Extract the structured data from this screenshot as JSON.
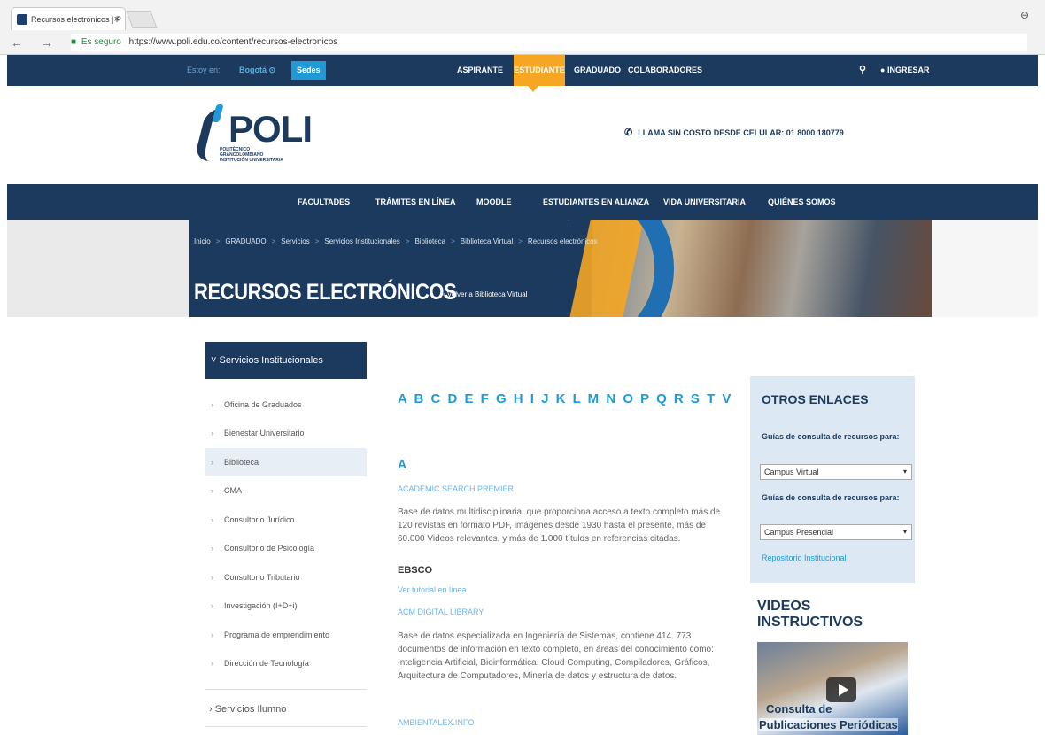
{
  "browser": {
    "tab_title": "Recursos electrónicos | P",
    "tab_close": "×",
    "address_secure": "Es seguro",
    "address_url": "https://www.poli.edu.co/content/recursos-electronicos",
    "nav_buttons": "← → C",
    "profile_icon": "⊖"
  },
  "topbar": {
    "estoy_en": "Estoy en:",
    "city": "Bogotá ⊙",
    "sedes": "Sedes",
    "tabs": [
      "ASPIRANTE",
      "ESTUDIANTE",
      "GRADUADO",
      "COLABORADORES"
    ],
    "active_tab": "ESTUDIANTE",
    "search_icon": "search-icon",
    "login": "INGRESAR"
  },
  "header": {
    "logo_text": "POLI",
    "logo_sub": "POLITÉCNICO GRANCOLOMBIANO INSTITUCIÓN UNIVERSITARIA",
    "phone_text": "LLAMA SIN COSTO DESDE CELULAR: 01 8000 180779"
  },
  "mainnav": {
    "items": [
      "FACULTADES",
      "TRÁMITES EN LÍNEA",
      "MOODLE",
      "ESTUDIANTES EN ALIANZA",
      "VIDA UNIVERSITARIA",
      "QUIÉNES SOMOS"
    ]
  },
  "banner": {
    "breadcrumb": [
      "Inicio",
      "GRADUADO",
      "Servicios",
      "Servicios Institucionales",
      "Biblioteca",
      "Biblioteca Virtual",
      "Recursos electrónicos"
    ],
    "breadcrumb_sep": ">",
    "title": "RECURSOS ELECTRÓNICOS",
    "back_link": "‹ Volver a Biblioteca Virtual"
  },
  "sidebar": {
    "header": "˅ Servicios Institucionales",
    "items": [
      {
        "label": "Oficina de Graduados",
        "active": false
      },
      {
        "label": "Bienestar Universitario",
        "active": false
      },
      {
        "label": "Biblioteca",
        "active": true
      },
      {
        "label": "CMA",
        "active": false
      },
      {
        "label": "Consultorio Jurídico",
        "active": false
      },
      {
        "label": "Consultorio de Psicología",
        "active": false
      },
      {
        "label": "Consultorio Tributario",
        "active": false
      },
      {
        "label": "Investigación (I+D+i)",
        "active": false
      },
      {
        "label": "Programa de emprendimiento",
        "active": false
      },
      {
        "label": "Dirección de Tecnología",
        "active": false
      }
    ],
    "chevron": "›",
    "extra": "› Servicios Ilumno"
  },
  "content": {
    "alphabet": "A B C D E F G H I J K L M N O P Q R S T V",
    "letter": "A",
    "entry1_title": "ACADEMIC SEARCH PREMIER",
    "entry1_desc": "Base de datos multidisciplinaria, que proporciona acceso a texto completo más de 120 revistas en formato PDF, imágenes desde 1930 hasta el presente, más de 60.000 Videos relevantes, y más de 1.000 títulos en referencias citadas.",
    "entry1_provider": "EBSCO",
    "entry1_tutorial": "Ver tutorial en línea",
    "entry2_title": "ACM DIGITAL LIBRARY",
    "entry2_desc": "Base de datos especializada en Ingeniería de Sistemas, contiene 414. 773 documentos de información en texto completo, en áreas del conocimiento como: Inteligencia Artificial, Bioinformática, Cloud Computing, Compiladores, Gráficos, Arquitectura de Computadores, Minería de datos y estructura de datos.",
    "entry3_title": "AMBIENTALEX.INFO"
  },
  "right": {
    "otros_title": "OTROS ENLACES",
    "guias_label": "Guías de consulta de recursos para:",
    "select1": "Campus Virtual",
    "select2": "Campus Presencial",
    "select_arrow": "▾",
    "repo_link": "Repositorio Institucional",
    "videos_title": "VIDEOS INSTRUCTIVOS",
    "video_caption1": "Consulta de",
    "video_caption2": "Publicaciones Periódicas"
  },
  "colors": {
    "navy": "#1b3a5e",
    "accent_orange": "#f5a623",
    "accent_blue": "#1f9ad6",
    "sidebar_active": "#e7eef6",
    "box_bg": "#dce8f4"
  }
}
